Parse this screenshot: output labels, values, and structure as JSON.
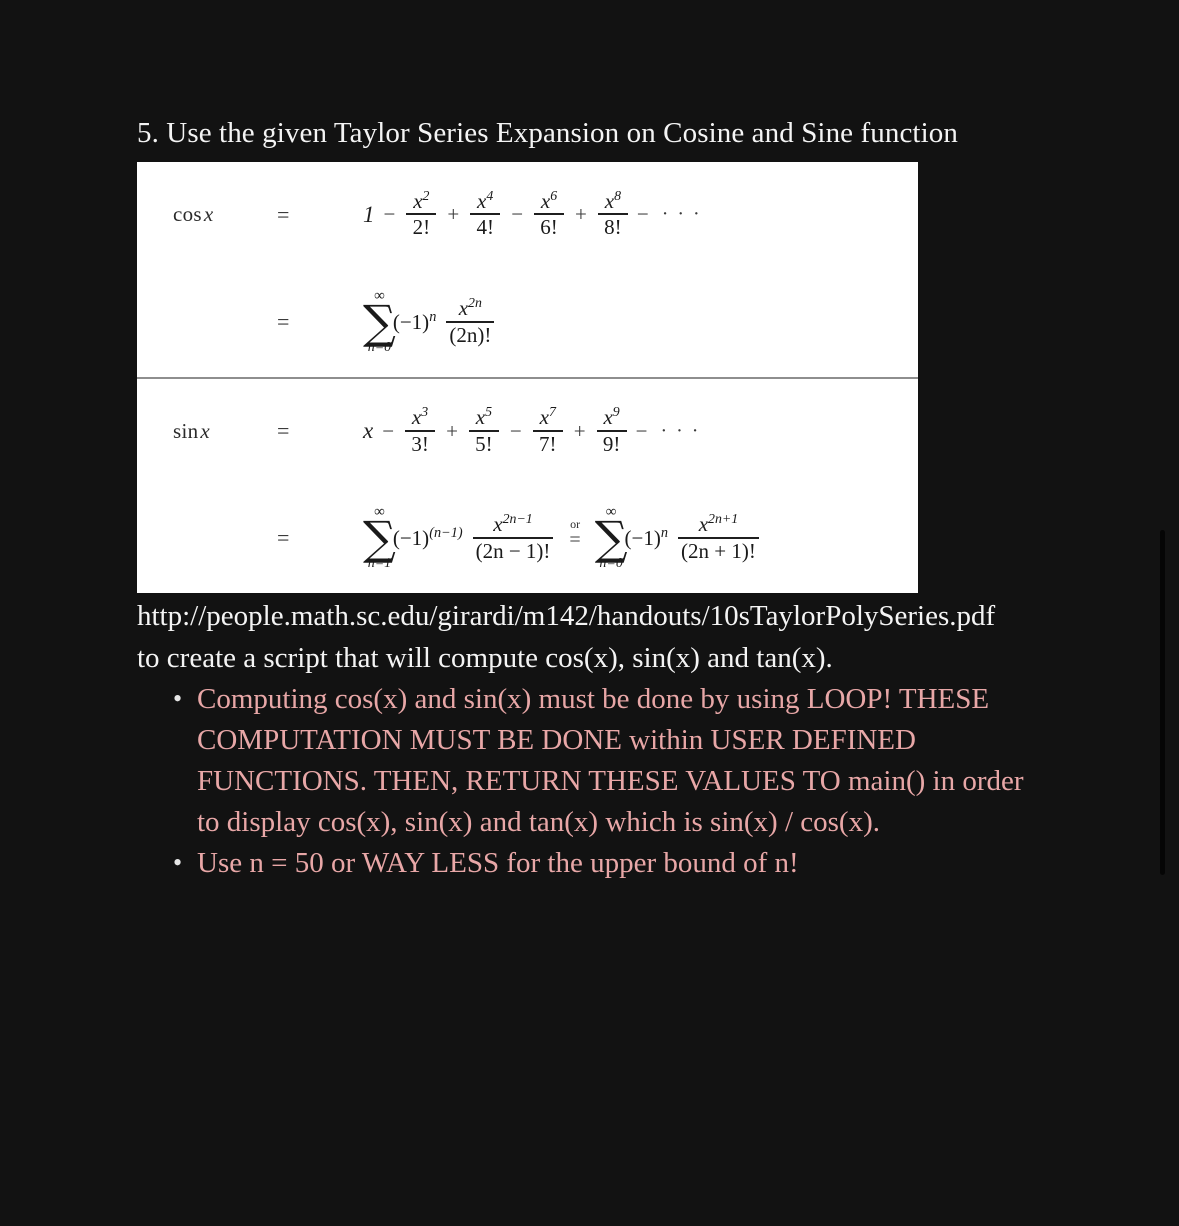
{
  "page": {
    "background_color": "#121212",
    "text_color": "#f4f4f4",
    "highlight_color": "#e8a7a7",
    "card_background": "#ffffff"
  },
  "question": {
    "number": "5.",
    "title": "5. Use the given Taylor Series Expansion on Cosine and Sine function"
  },
  "formula_card": {
    "cos": {
      "label_fn": "cos",
      "label_var": "x",
      "equals": "=",
      "expansion": {
        "first_term": "1",
        "terms": [
          {
            "op": "−",
            "num": "x",
            "power": "2",
            "den": "2!"
          },
          {
            "op": "+",
            "num": "x",
            "power": "4",
            "den": "4!"
          },
          {
            "op": "−",
            "num": "x",
            "power": "6",
            "den": "6!"
          },
          {
            "op": "+",
            "num": "x",
            "power": "8",
            "den": "8!"
          }
        ],
        "tail_op": "−",
        "ellipsis": "· · ·"
      },
      "summation": {
        "equals": "=",
        "upper_limit": "∞",
        "sigma": "∑",
        "lower_limit": "n=0",
        "sign_factor": "(−1)",
        "sign_exponent": "n",
        "numerator": "x",
        "numerator_power": "2n",
        "denominator": "(2n)!"
      }
    },
    "sin": {
      "label_fn": "sin",
      "label_var": "x",
      "equals": "=",
      "expansion": {
        "first_term": "x",
        "terms": [
          {
            "op": "−",
            "num": "x",
            "power": "3",
            "den": "3!"
          },
          {
            "op": "+",
            "num": "x",
            "power": "5",
            "den": "5!"
          },
          {
            "op": "−",
            "num": "x",
            "power": "7",
            "den": "7!"
          },
          {
            "op": "+",
            "num": "x",
            "power": "9",
            "den": "9!"
          }
        ],
        "tail_op": "−",
        "ellipsis": "· · ·"
      },
      "summation_left": {
        "equals": "=",
        "upper_limit": "∞",
        "sigma": "∑",
        "lower_limit": "n=1",
        "sign_factor": "(−1)",
        "sign_exponent": "(n−1)",
        "numerator": "x",
        "numerator_power": "2n−1",
        "denominator": "(2n − 1)!"
      },
      "connector": {
        "word": "or",
        "sign": "="
      },
      "summation_right": {
        "upper_limit": "∞",
        "sigma": "∑",
        "lower_limit": "n=0",
        "sign_factor": "(−1)",
        "sign_exponent": "n",
        "numerator": "x",
        "numerator_power": "2n+1",
        "denominator": "(2n + 1)!"
      }
    }
  },
  "source_url": "http://people.math.sc.edu/girardi/m142/handouts/10sTaylorPolySeries.pdf",
  "instruction": "to create a script that will compute cos(x), sin(x) and tan(x).",
  "bullets": [
    "Computing cos(x) and sin(x) must be done by using LOOP! THESE COMPUTATION MUST BE DONE within USER DEFINED FUNCTIONS. THEN, RETURN THESE VALUES TO main() in order to display cos(x), sin(x) and tan(x) which is sin(x) / cos(x).",
    "Use n = 50 or WAY LESS for the upper bound of n!"
  ]
}
